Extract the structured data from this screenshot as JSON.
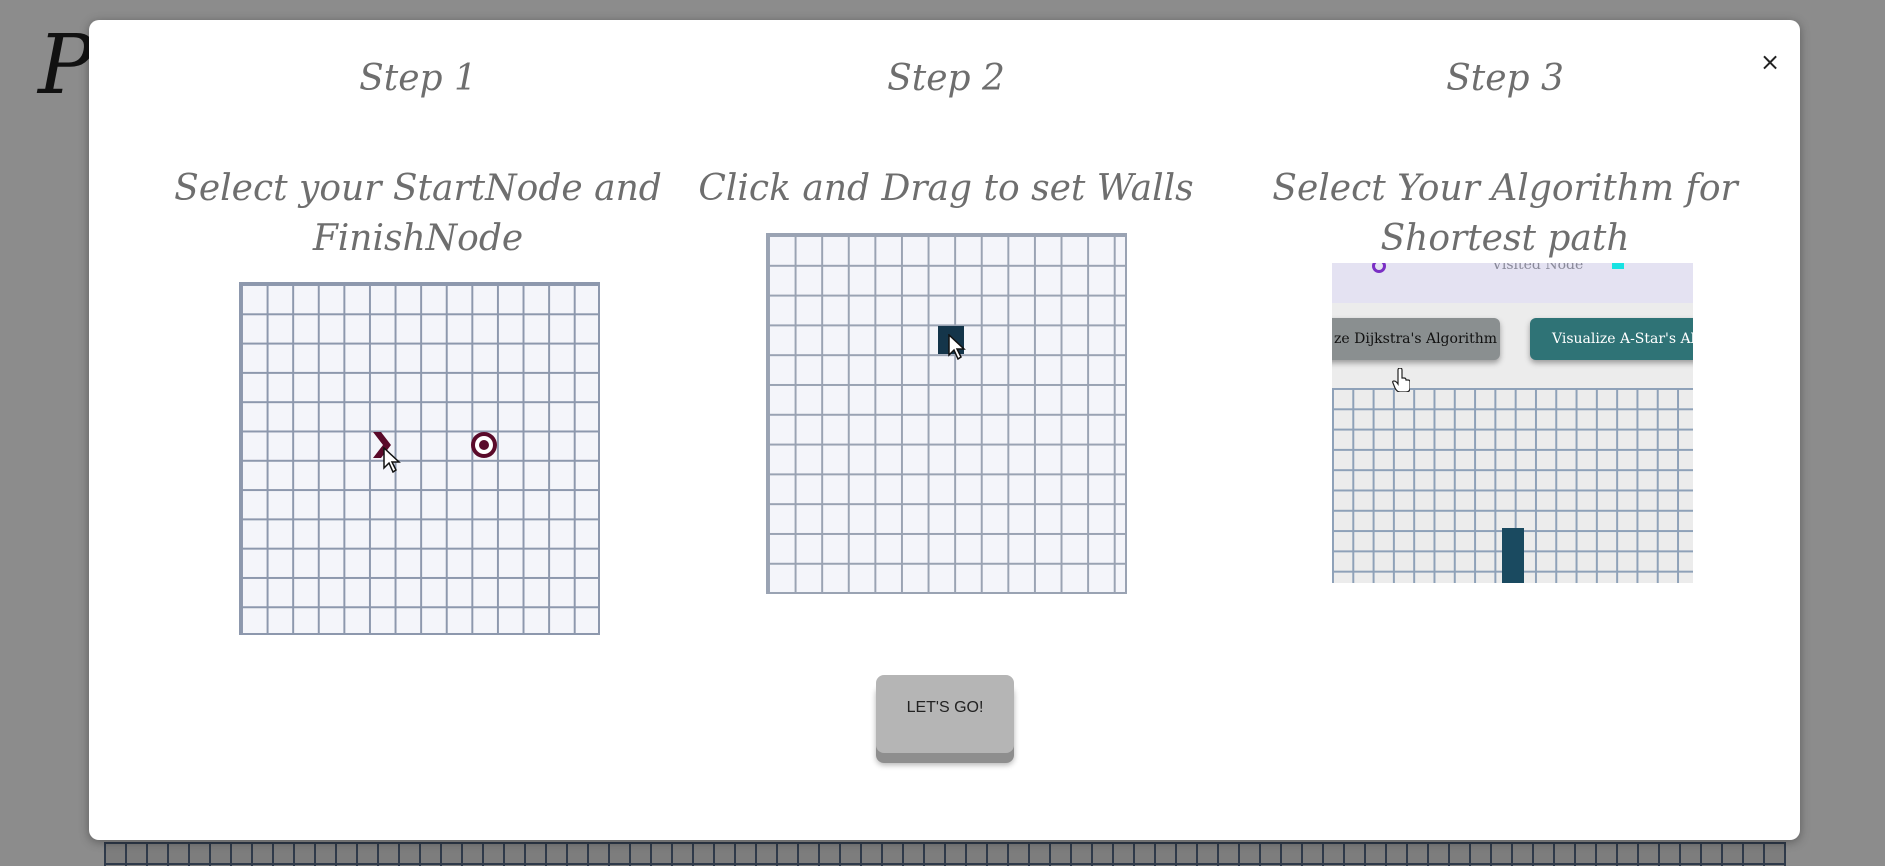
{
  "background": {
    "title_fragment": "Pa"
  },
  "modal": {
    "close_label": "×",
    "steps": [
      {
        "heading": "Step 1",
        "text": "Select your StartNode and FinishNode"
      },
      {
        "heading": "Step 2",
        "text": "Click and Drag to set Walls"
      },
      {
        "heading": "Step 3",
        "text": "Select Your Algorithm for Shortest path"
      }
    ],
    "preview": {
      "legend_text": "Visited Node",
      "dijkstra_button": "ze Dijkstra's Algorithm",
      "astar_button": "Visualize A-Star's Algo"
    },
    "go_button": "LET'S GO!"
  },
  "colors": {
    "overlay": "#8c8c8c",
    "heading_text": "#6e6e6e",
    "start_node": "#5a0a2a",
    "wall": "#14354a",
    "astar_button": "#2f7376"
  }
}
